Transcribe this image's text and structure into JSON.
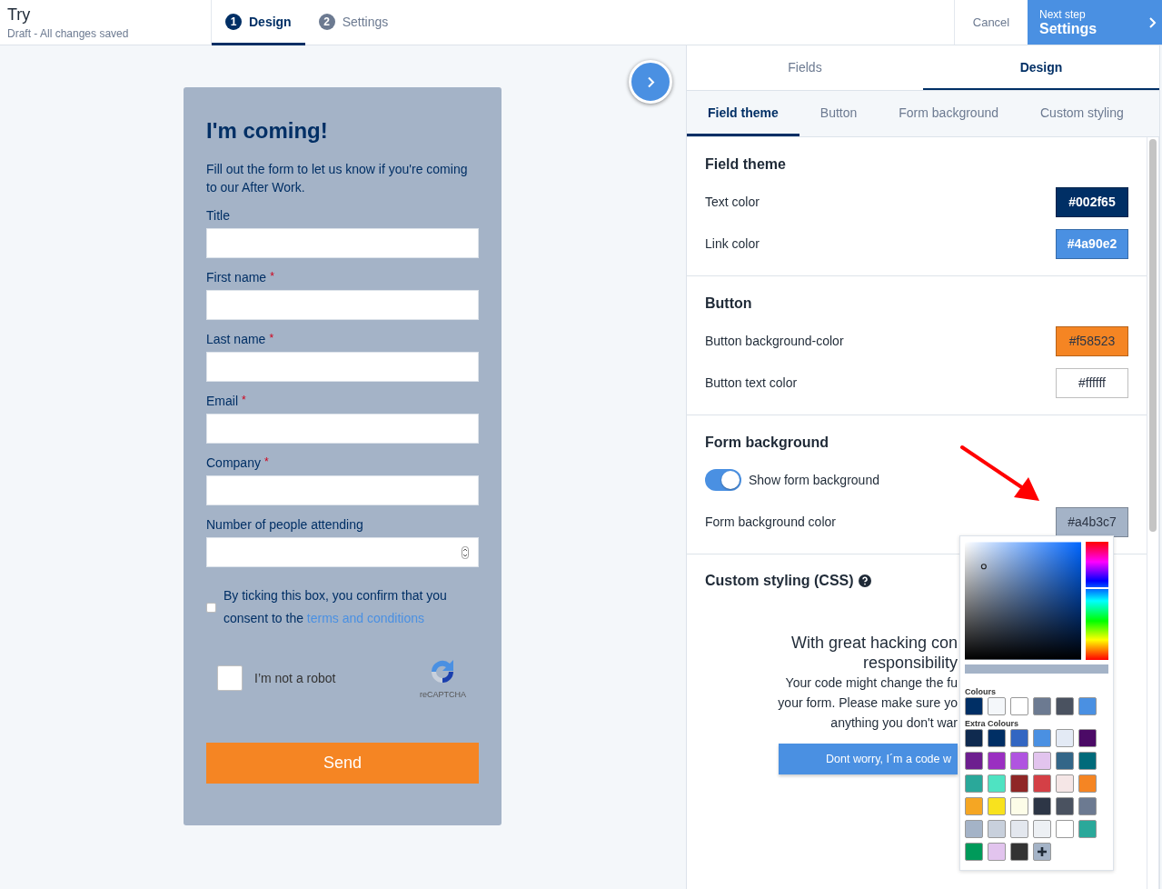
{
  "header": {
    "title": "Try",
    "status": "Draft - All changes saved",
    "steps": [
      {
        "number": "1",
        "label": "Design",
        "selected": true
      },
      {
        "number": "2",
        "label": "Settings",
        "selected": false
      }
    ],
    "cancel": "Cancel",
    "next": {
      "caption": "Next step",
      "label": "Settings"
    }
  },
  "form": {
    "title": "I'm coming!",
    "description": "Fill out the form to let us know if you're coming to our After Work.",
    "required_mark": "*",
    "fields": [
      {
        "label": "Title",
        "required": false,
        "kind": "text"
      },
      {
        "label": "First name",
        "required": true,
        "kind": "text"
      },
      {
        "label": "Last name",
        "required": true,
        "kind": "text"
      },
      {
        "label": "Email",
        "required": true,
        "kind": "text"
      },
      {
        "label": "Company",
        "required": true,
        "kind": "text"
      },
      {
        "label": "Number of people attending",
        "required": false,
        "kind": "number"
      }
    ],
    "consent": {
      "checked": false,
      "text": "By ticking this box, you confirm that you consent to the",
      "link": "terms and conditions"
    },
    "captcha": {
      "checked": false,
      "label": "I’m not a robot",
      "brand": "reCAPTCHA"
    },
    "submit": "Send"
  },
  "panel": {
    "tabs": [
      {
        "label": "Fields",
        "selected": false
      },
      {
        "label": "Design",
        "selected": true
      }
    ],
    "subtabs": [
      {
        "label": "Field theme",
        "selected": true
      },
      {
        "label": "Button",
        "selected": false
      },
      {
        "label": "Form background",
        "selected": false
      },
      {
        "label": "Custom styling",
        "selected": false
      }
    ],
    "sections": [
      {
        "title": "Field theme",
        "rows": [
          {
            "kind": "color",
            "label": "Text color",
            "value": "#002f65"
          },
          {
            "kind": "color",
            "label": "Link color",
            "value": "#4a90e2"
          }
        ]
      },
      {
        "title": "Button",
        "rows": [
          {
            "kind": "color",
            "label": "Button background-color",
            "value": "#f58523"
          },
          {
            "kind": "color",
            "label": "Button text color",
            "value": "#ffffff"
          }
        ]
      },
      {
        "title": "Form background",
        "rows": [
          {
            "kind": "toggle",
            "label": "Show form background",
            "on": true
          },
          {
            "kind": "color",
            "label": "Form background color",
            "value": "#a4b3c7"
          }
        ]
      }
    ],
    "custom": {
      "title": "Custom styling (CSS)",
      "heading_lines": [
        "With great hacking con",
        "responsibility"
      ],
      "body_lines": [
        "Your code might change the fu",
        "your form. Please make sure yo",
        "anything you don't war"
      ],
      "button": "Dont worry, I´m a code w"
    },
    "picker": {
      "hue_slider": {
        "level": 0.6
      },
      "colours_label": "Colours",
      "colours": [
        {
          "color": "#002f65"
        },
        {
          "color": "#f4f7fa"
        },
        {
          "color": "#ffffff"
        },
        {
          "color": "#6c7a91"
        },
        {
          "color": "#4a5260"
        },
        {
          "color": "#4a90e2"
        }
      ],
      "extra_label": "Extra Colours",
      "extra": [
        {
          "color": "#0f2a4f"
        },
        {
          "color": "#002f65"
        },
        {
          "color": "#3366c2"
        },
        {
          "color": "#4a90e2"
        },
        {
          "color": "#e3eaf5"
        },
        {
          "color": "#4b0a66"
        },
        {
          "color": "#6d1f8f"
        },
        {
          "color": "#9a2fc1"
        },
        {
          "color": "#b054e0"
        },
        {
          "color": "#e2c4ee"
        },
        {
          "color": "#336688"
        },
        {
          "color": "#006a7a"
        },
        {
          "color": "#2aa89a"
        },
        {
          "color": "#4fe3c2"
        },
        {
          "color": "#8f2626"
        },
        {
          "color": "#d44046"
        },
        {
          "color": "#f5e6e6"
        },
        {
          "color": "#f58523"
        },
        {
          "color": "#f5a623"
        },
        {
          "color": "#f8e21e"
        },
        {
          "color": "#fdfde8"
        },
        {
          "color": "#2d3646"
        },
        {
          "color": "#4a5260"
        },
        {
          "color": "#6c7a91"
        },
        {
          "color": "#a4b3c7"
        },
        {
          "color": "#c8d0dc"
        },
        {
          "color": "#e3e7ee"
        },
        {
          "color": "#edf0f4"
        },
        {
          "color": "#ffffff"
        },
        {
          "color": "#2aa89a"
        },
        {
          "color": "#009a5a"
        },
        {
          "color": "#e2c4ee"
        },
        {
          "color": "#333333"
        }
      ]
    }
  }
}
